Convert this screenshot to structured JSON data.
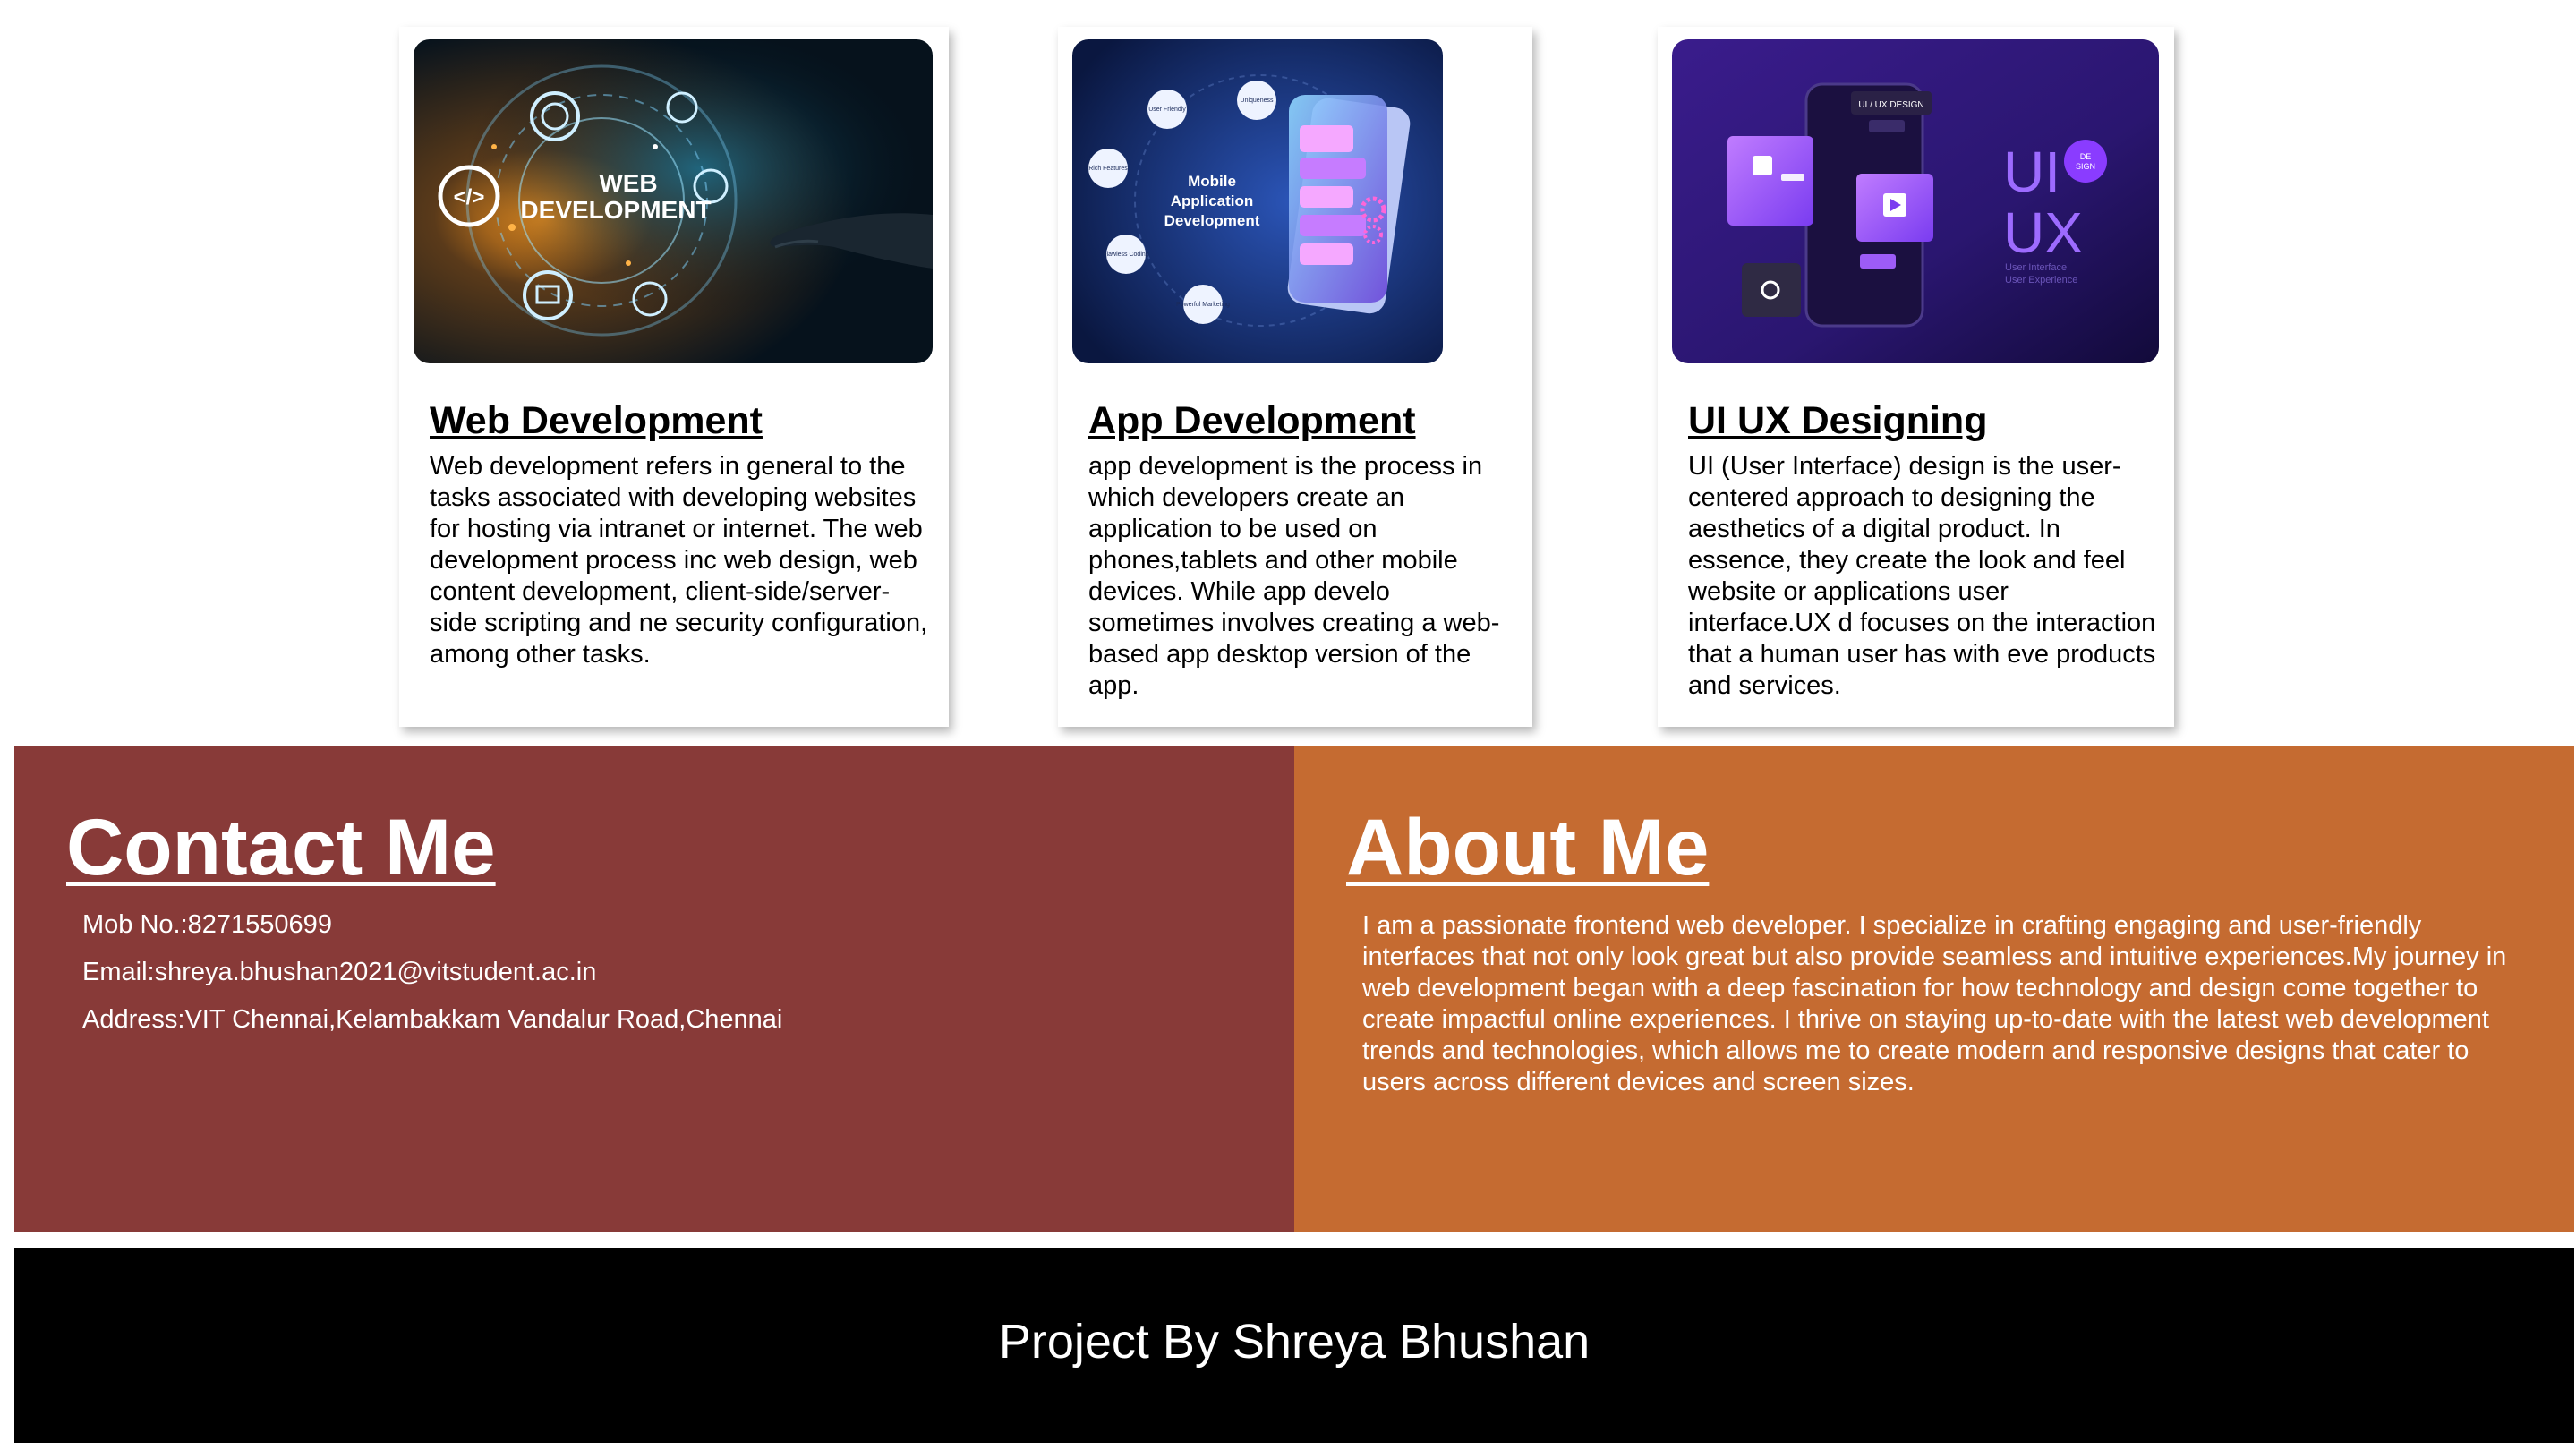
{
  "services": [
    {
      "title": "Web Development",
      "description": "Web development refers in general to the tasks associated with developing websites for hosting via intranet or internet. The web development process inc web design, web content development, client-side/server-side scripting and ne security configuration, among other tasks.",
      "image": {
        "label_line1": "WEB",
        "label_line2": "DEVELOPMENT"
      }
    },
    {
      "title": "App Development",
      "description": "app development is the process in which developers create an application to be used on phones,tablets and other mobile devices. While app develo sometimes involves creating a web-based app desktop version of the app.",
      "image": {
        "label_line1": "Mobile",
        "label_line2": "Application",
        "label_line3": "Development",
        "bubbles": [
          "User Friendly",
          "Uniqueness",
          "Rich Features",
          "Flawless Coding",
          "Powerful Marketing"
        ]
      }
    },
    {
      "title": "UI UX Designing",
      "description": "UI (User Interface) design is the user-centered approach to designing the aesthetics of a digital product. In essence, they create the look and feel website or applications user interface.UX d focuses on the interaction that a human user has with eve products and services.",
      "image": {
        "label_ui": "UI",
        "label_ux": "UX",
        "badge_line1": "DE",
        "badge_line2": "SIGN",
        "tag": "UI / UX DESIGN",
        "caption_line1": "User Interface",
        "caption_line2": "User Experience"
      }
    }
  ],
  "contact": {
    "title": "Contact Me",
    "mobile": "Mob No.:8271550699",
    "email": "Email:shreya.bhushan2021@vitstudent.ac.in",
    "address": "Address:VIT Chennai,Kelambakkam Vandalur Road,Chennai"
  },
  "about": {
    "title": "About Me",
    "text": "I am a passionate frontend web developer. I specialize in crafting engaging and user-friendly interfaces that not only look great but also provide seamless and intuitive experiences.My journey in web development began with a deep fascination for how technology and design come together to create impactful online experiences. I thrive on staying up-to-date with the latest web development trends and technologies, which allows me to create modern and responsive designs that cater to users across different devices and screen sizes."
  },
  "footer": {
    "text": "Project By Shreya Bhushan"
  },
  "colors": {
    "contact_bg": "#883a38",
    "about_bg": "#c56b31",
    "footer_bg": "#000000"
  }
}
